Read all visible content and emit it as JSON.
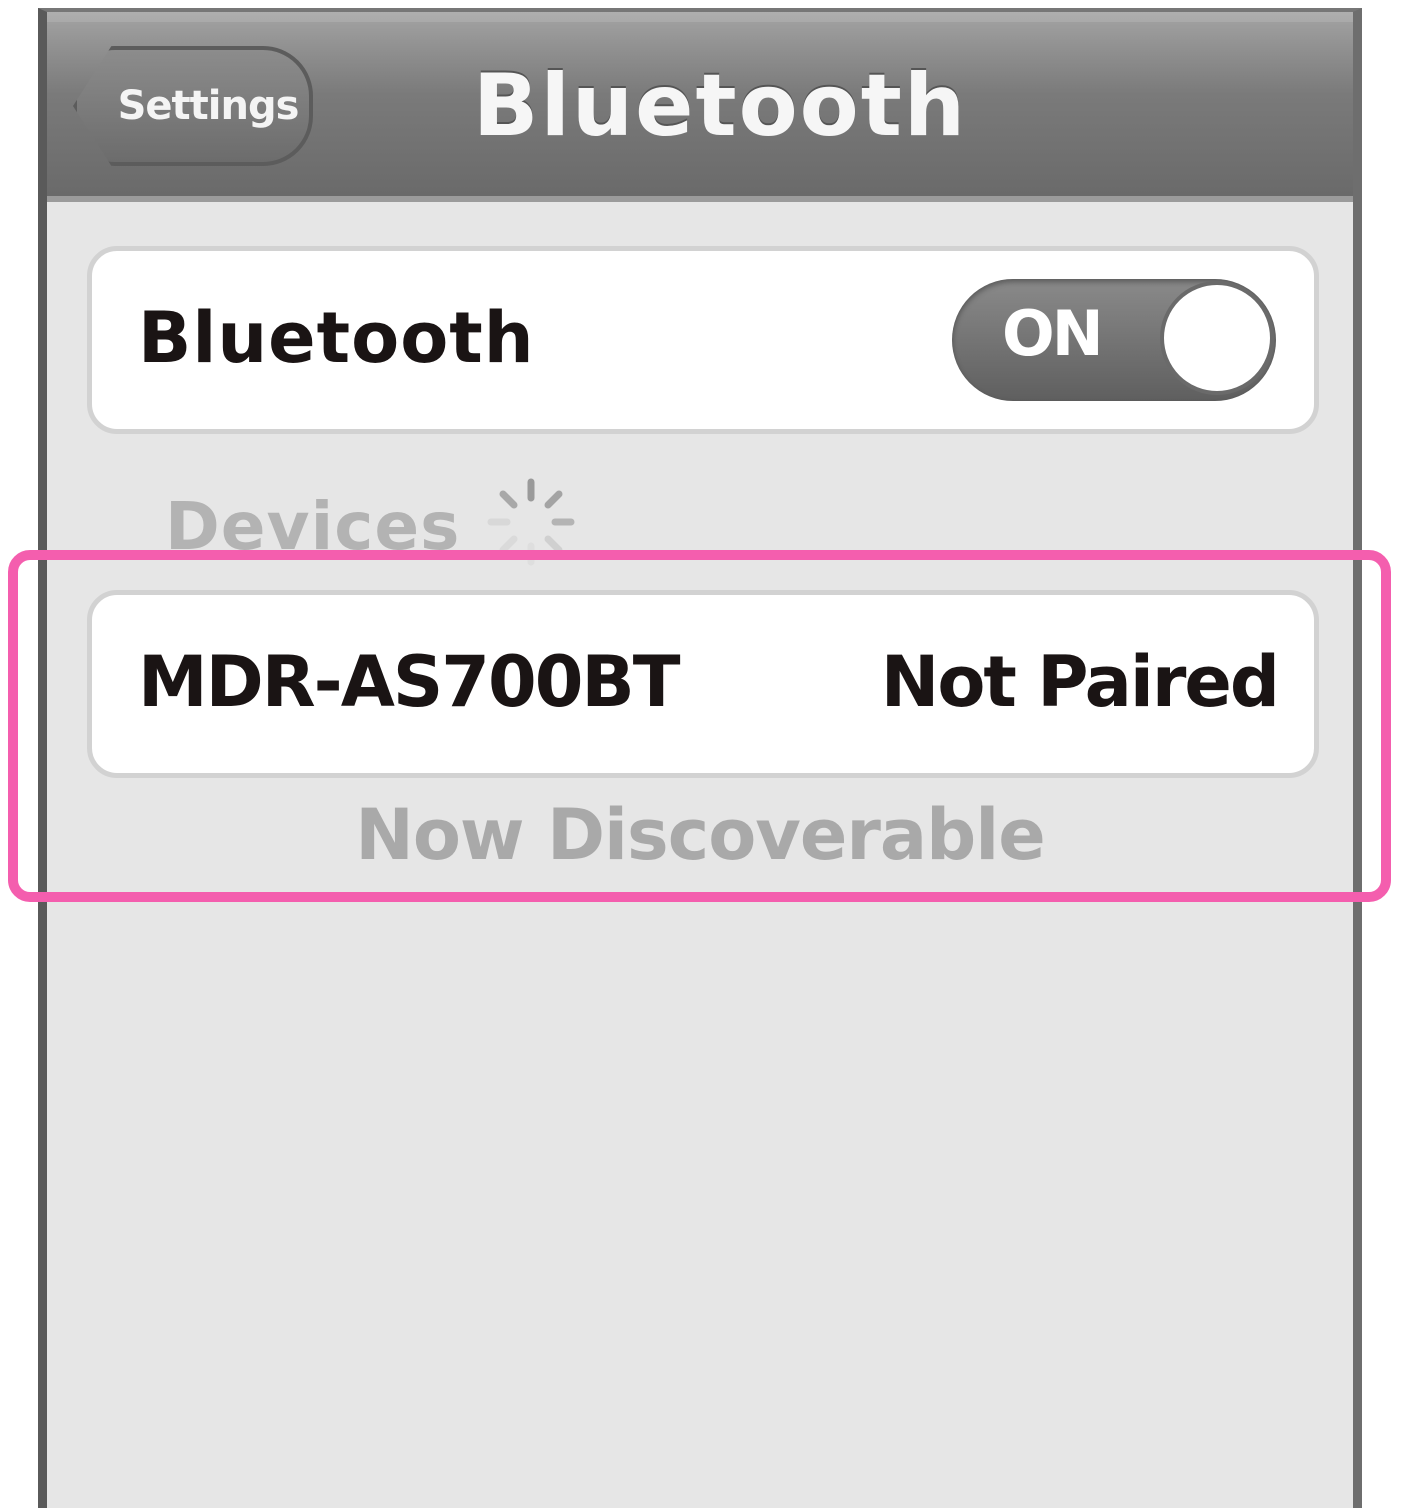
{
  "navbar": {
    "back_label": "Settings",
    "title": "Bluetooth"
  },
  "bluetooth_row": {
    "label": "Bluetooth",
    "toggle_state": "ON"
  },
  "devices": {
    "header": "Devices",
    "items": [
      {
        "name": "MDR-AS700BT",
        "status": "Not Paired"
      }
    ]
  },
  "discoverable_text": "Now Discoverable",
  "colors": {
    "highlight": "#f45eae",
    "navbar": "#7a7a7a",
    "background": "#e6e6e6"
  }
}
